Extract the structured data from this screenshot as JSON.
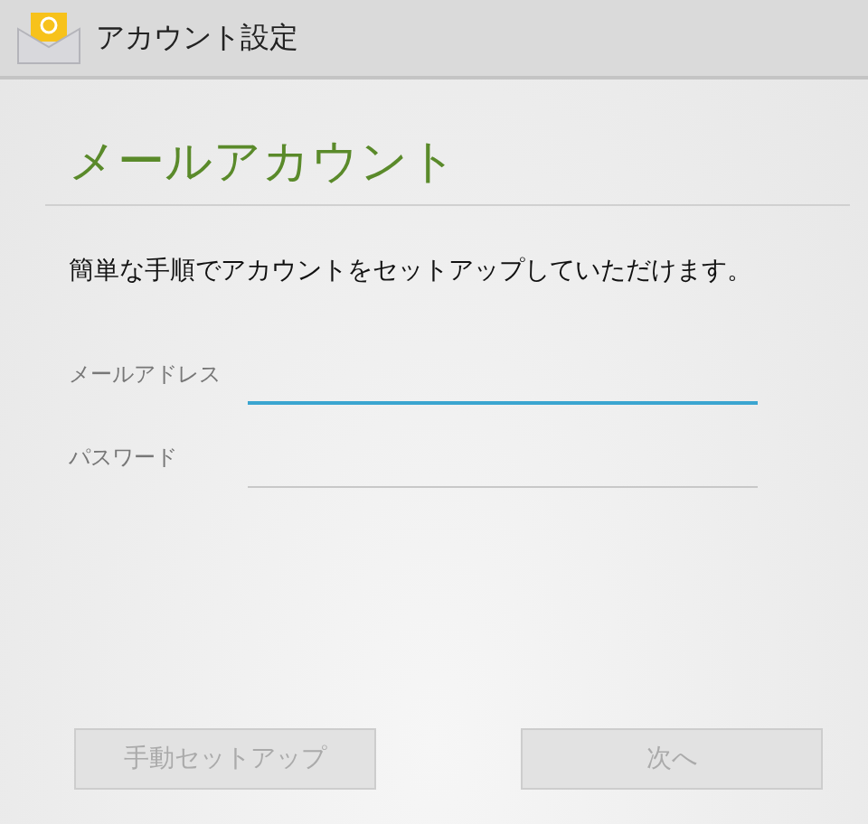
{
  "window": {
    "title": "アカウント設定"
  },
  "heading": "メールアカウント",
  "description": "簡単な手順でアカウントをセットアップしていただけます。",
  "fields": [
    {
      "label": "メールアドレス",
      "focused": true
    },
    {
      "label": "パスワード",
      "focused": false
    }
  ],
  "buttons": [
    {
      "label": "手動セットアップ",
      "disabled": true
    },
    {
      "label": "次へ",
      "disabled": true
    }
  ]
}
